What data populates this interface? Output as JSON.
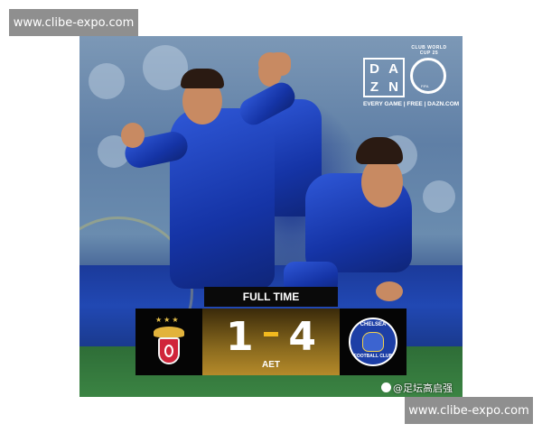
{
  "watermark": {
    "top_text": "www.clibe-expo.com",
    "bottom_text": "www.clibe-expo.com"
  },
  "broadcast": {
    "logo_letters": [
      "D",
      "A",
      "Z",
      "N"
    ],
    "tournament_logo_text": "CLUB WORLD CUP 25",
    "fifa_text": "FIFA",
    "tagline": "EVERY GAME | FREE | DAZN.COM"
  },
  "scoreboard": {
    "status": "FULL TIME",
    "home_score": "1",
    "away_score": "4",
    "note": "AET",
    "home_stars": "★★★",
    "away_badge_text": "CHELSEA",
    "away_badge_bottom_text": "FOOTBALL CLUB",
    "accent_color": "#f2b91e",
    "home_crest_color": "#d0253a",
    "away_crest_color": "#1d3fa6"
  },
  "credit": {
    "text": "@足坛高启强"
  }
}
